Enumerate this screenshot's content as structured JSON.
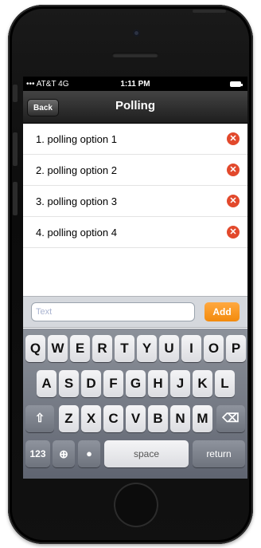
{
  "status_bar": {
    "carrier": "AT&T 4G",
    "time": "1:11 PM"
  },
  "nav": {
    "back_label": "Back",
    "title": "Polling"
  },
  "options": [
    {
      "number": "1.",
      "label": "polling option 1"
    },
    {
      "number": "2.",
      "label": "polling option 2"
    },
    {
      "number": "3.",
      "label": "polling option 3"
    },
    {
      "number": "4.",
      "label": "polling option 4"
    }
  ],
  "input": {
    "placeholder": "Text",
    "value": "",
    "add_label": "Add"
  },
  "keyboard": {
    "row1": [
      "Q",
      "W",
      "E",
      "R",
      "T",
      "Y",
      "U",
      "I",
      "O",
      "P"
    ],
    "row2": [
      "A",
      "S",
      "D",
      "F",
      "G",
      "H",
      "J",
      "K",
      "L"
    ],
    "row3": [
      "Z",
      "X",
      "C",
      "V",
      "B",
      "N",
      "M"
    ],
    "numbers_label": "123",
    "space_label": "space",
    "return_label": "return"
  },
  "colors": {
    "add_button": "#f7941d",
    "delete_icon": "#e2492c",
    "nav_bar": "#2b2b2b"
  }
}
